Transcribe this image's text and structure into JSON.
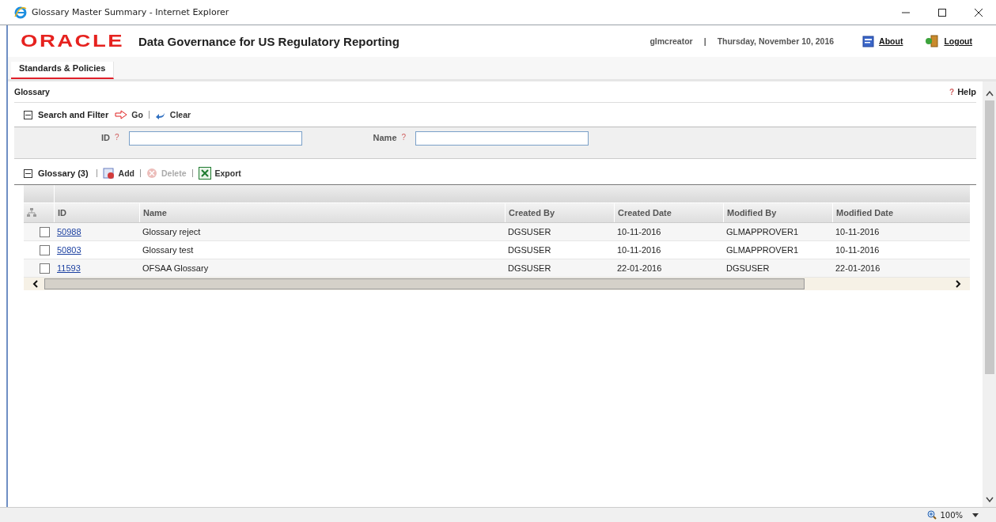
{
  "window": {
    "title": "Glossary Master Summary - Internet Explorer"
  },
  "header": {
    "logo": "ORACLE",
    "app_title": "Data Governance for US Regulatory Reporting",
    "user": "glmcreator",
    "separator": "|",
    "date": "Thursday, November 10, 2016",
    "links": [
      {
        "label": "About",
        "kind": "about"
      },
      {
        "label": "Logout",
        "kind": "logout"
      }
    ]
  },
  "tabs": [
    {
      "label": "Standards & Policies",
      "selected": true
    }
  ],
  "page": {
    "title": "Glossary",
    "help": "Help",
    "help_mark": "?"
  },
  "search": {
    "title": "Search and Filter",
    "expanded": true,
    "actions": [
      {
        "label": "Go",
        "kind": "go"
      },
      {
        "label": "Clear",
        "kind": "clear"
      }
    ],
    "fields": [
      {
        "label": "ID",
        "hint": "?"
      },
      {
        "label": "Name",
        "hint": "?"
      }
    ]
  },
  "grid": {
    "title": "Glossary (3)",
    "expanded": true,
    "actions": [
      {
        "label": "Add",
        "kind": "add",
        "disabled": false
      },
      {
        "label": "Delete",
        "kind": "delete",
        "disabled": true
      },
      {
        "label": "Export",
        "kind": "export",
        "disabled": false
      }
    ],
    "columns": [
      "ID",
      "Name",
      "Created By",
      "Created Date",
      "Modified By",
      "Modified Date"
    ],
    "rows": [
      {
        "checked": false,
        "cells": [
          "50988",
          "Glossary reject",
          "DGSUSER",
          "10-11-2016",
          "GLMAPPROVER1",
          "10-11-2016"
        ]
      },
      {
        "checked": false,
        "cells": [
          "50803",
          "Glossary test",
          "DGSUSER",
          "10-11-2016",
          "GLMAPPROVER1",
          "10-11-2016"
        ]
      },
      {
        "checked": false,
        "cells": [
          "11593",
          "OFSAA Glossary",
          "DGSUSER",
          "22-01-2016",
          "DGSUSER",
          "22-01-2016"
        ]
      }
    ]
  },
  "status_bar": {
    "zoom": "100%"
  }
}
